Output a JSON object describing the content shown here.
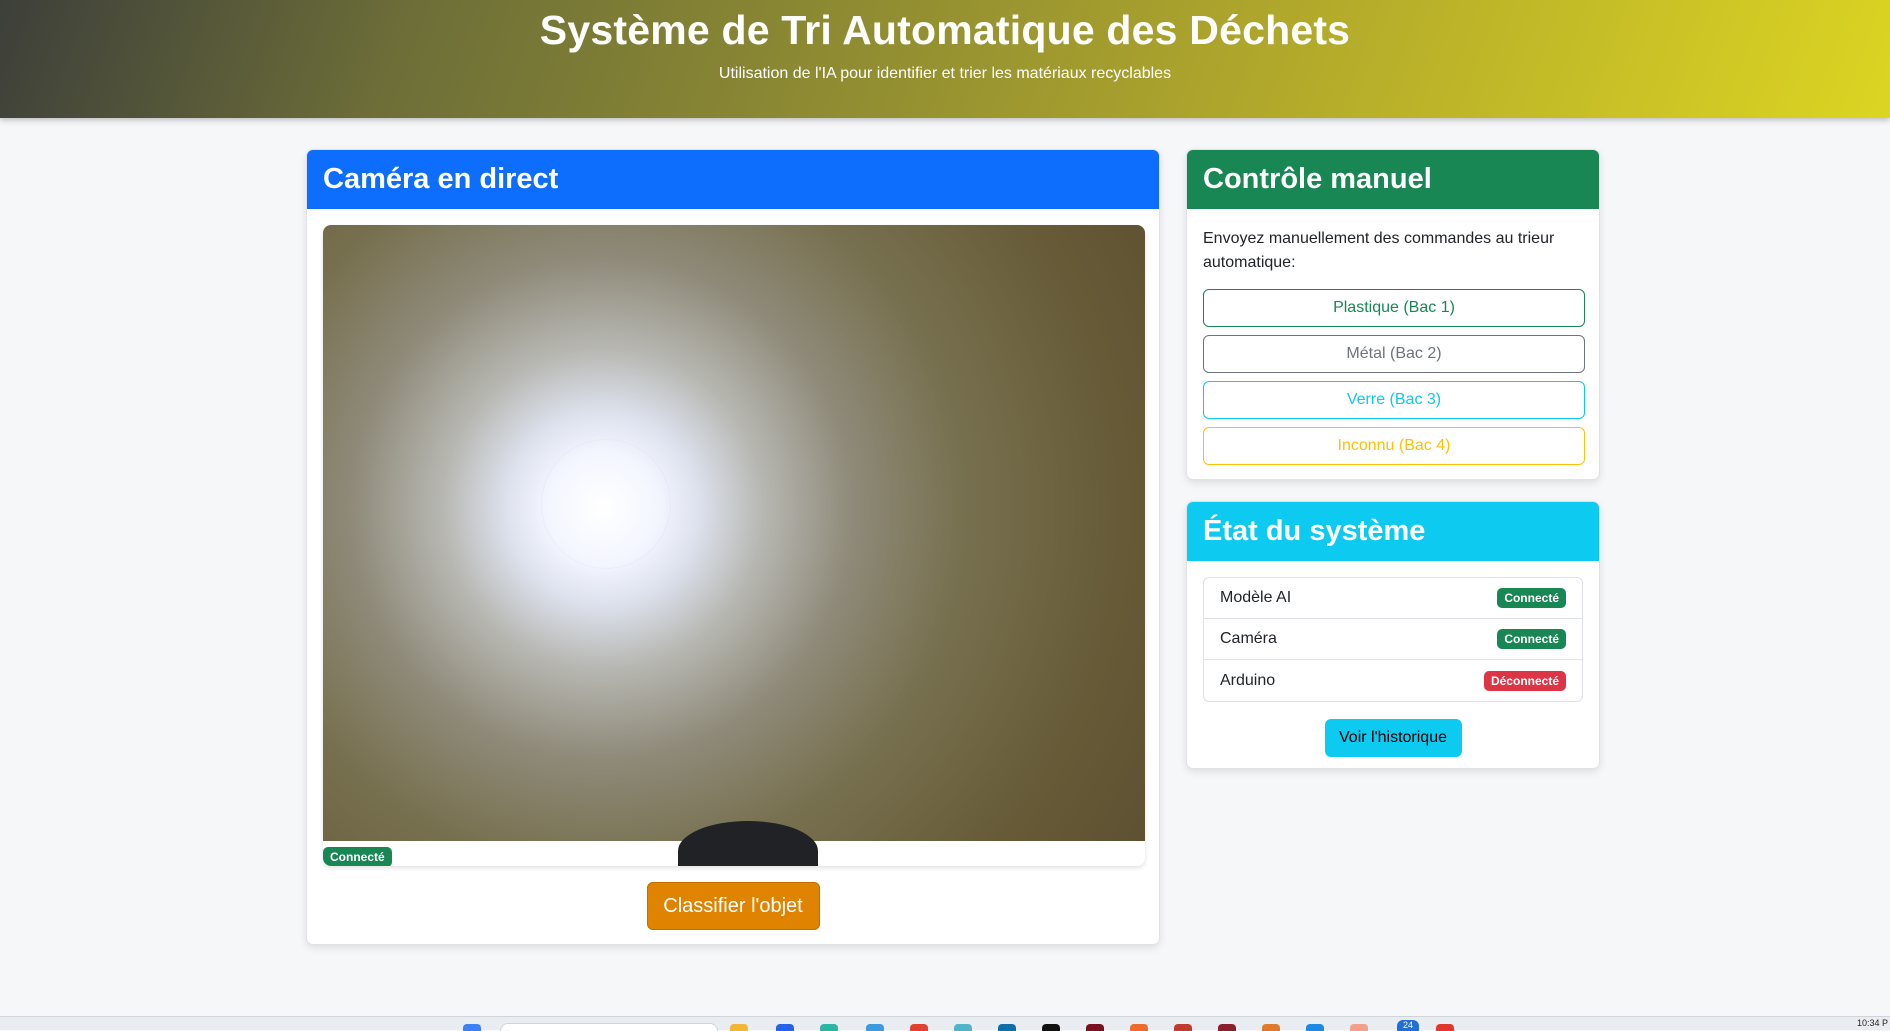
{
  "header": {
    "title": "Système de Tri Automatique des Déchets",
    "subtitle": "Utilisation de l'IA pour identifier et trier les matériaux recyclables"
  },
  "camera": {
    "title": "Caméra en direct",
    "status_badge": "Connecté",
    "classify_label": "Classifier l'objet"
  },
  "manual": {
    "title": "Contrôle manuel",
    "intro": "Envoyez manuellement des commandes au trieur automatique:",
    "buttons": [
      {
        "label": "Plastique (Bac 1)",
        "color": "#198754"
      },
      {
        "label": "Métal (Bac 2)",
        "color": "#6c757d"
      },
      {
        "label": "Verre (Bac 3)",
        "color": "#0dcaf0"
      },
      {
        "label": "Inconnu (Bac 4)",
        "color": "#ffc107"
      }
    ]
  },
  "system_status": {
    "title": "État du système",
    "rows": [
      {
        "label": "Modèle AI",
        "status": "Connecté",
        "state_color": "#198754"
      },
      {
        "label": "Caméra",
        "status": "Connecté",
        "state_color": "#198754"
      },
      {
        "label": "Arduino",
        "status": "Déconnecté",
        "state_color": "#dc3545"
      }
    ],
    "history_label": "Voir l'historique"
  },
  "taskbar": {
    "notification_count": "24",
    "clock": "10:34 P"
  },
  "colors": {
    "primary": "#0d6efd",
    "success": "#198754",
    "info": "#0dcaf0",
    "warning": "#ffc107",
    "danger": "#dc3545",
    "classify": "#e08300"
  }
}
